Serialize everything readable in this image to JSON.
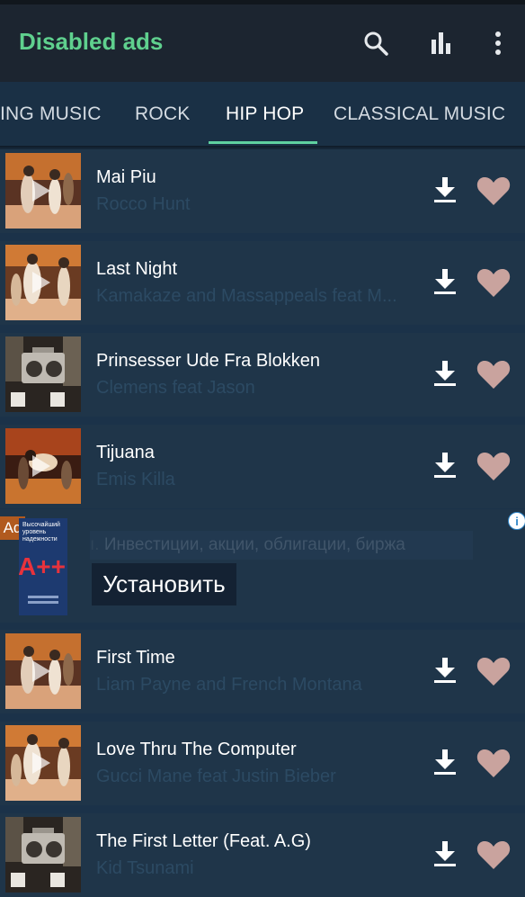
{
  "app": {
    "title": "Disabled ads"
  },
  "toolbar": {
    "search_icon": "search-icon",
    "equalizer_icon": "equalizer-icon",
    "more_icon": "more-vert-icon"
  },
  "tabs": [
    {
      "label": "ING MUSIC"
    },
    {
      "label": "ROCK"
    },
    {
      "label": "HIP HOP",
      "active": true
    },
    {
      "label": "CLASSICAL MUSIC"
    }
  ],
  "tracks": [
    {
      "title": "Mai Piu",
      "artist": "Rocco Hunt"
    },
    {
      "title": "Last Night",
      "artist": "Kamakaze and Massappeals feat M..."
    },
    {
      "title": "Prinsesser Ude Fra Blokken",
      "artist": "Clemens feat Jason"
    },
    {
      "title": "Tijuana",
      "artist": "Emis Killa"
    },
    {
      "title": "First Time",
      "artist": "Liam Payne and French Montana"
    },
    {
      "title": "Love Thru The Computer",
      "artist": "Gucci Mane feat Justin Bieber"
    },
    {
      "title": "The First Letter (Feat. A.G)",
      "artist": "Kid Tsunami"
    }
  ],
  "ad": {
    "badge": "Ad",
    "text": "Инвестиции, акции, облигации, биржа",
    "install_label": "Установить",
    "info_icon": "info-icon",
    "image_headline": "Высочайший уровень надежности",
    "image_rating": "A++"
  },
  "colors": {
    "accent": "#5fd08e",
    "tab_indicator": "#5fd0a0",
    "heart": "#c9a39e",
    "background": "#1b3249"
  }
}
